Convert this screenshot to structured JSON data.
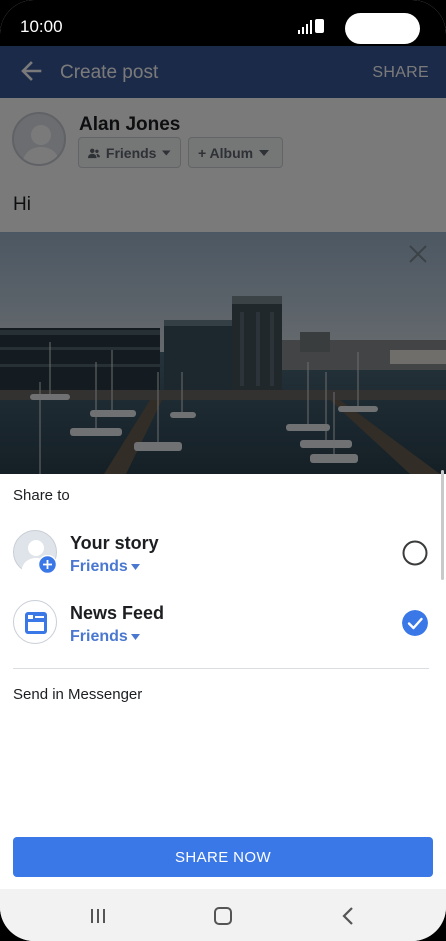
{
  "status_bar": {
    "time": "10:00"
  },
  "header": {
    "title": "Create post",
    "share_label": "SHARE"
  },
  "composer": {
    "author": "Alan Jones",
    "audience_label": "Friends",
    "album_label": "+ Album",
    "post_text": "Hi"
  },
  "sheet": {
    "share_to_label": "Share to",
    "options": [
      {
        "title": "Your story",
        "audience": "Friends",
        "selected": false,
        "icon": "story-avatar-icon"
      },
      {
        "title": "News Feed",
        "audience": "Friends",
        "selected": true,
        "icon": "news-feed-icon"
      }
    ],
    "messenger_label": "Send in Messenger",
    "share_now_label": "SHARE NOW"
  },
  "colors": {
    "header_blue": "#3b5998",
    "accent_blue": "#3b78e7",
    "audience_blue": "#4a78d0"
  }
}
